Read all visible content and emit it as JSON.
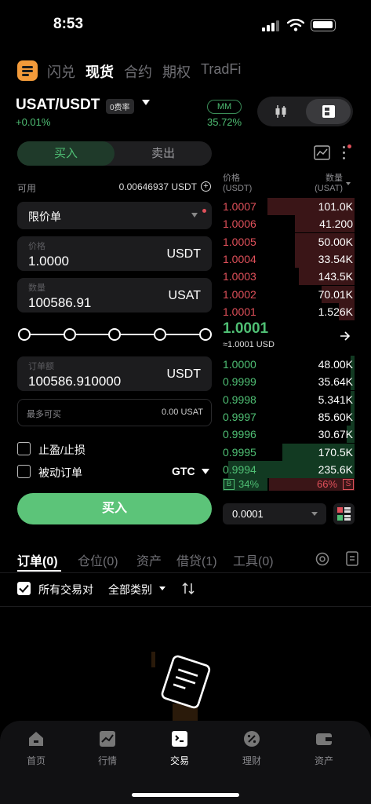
{
  "status_bar": {
    "time": "8:53"
  },
  "top_nav": {
    "items": [
      "闪兑",
      "现货",
      "合约",
      "期权",
      "TradFi"
    ],
    "active": "现货"
  },
  "pair": {
    "name": "USAT/USDT",
    "fee_badge": "0费率",
    "change": "+0.01%",
    "mm_label": "MM",
    "mm_value": "35.72%"
  },
  "trade_form": {
    "buy_tab": "买入",
    "sell_tab": "卖出",
    "available_label": "可用",
    "available_value": "0.00646937 USDT",
    "order_type": "限价单",
    "price_label": "价格",
    "price_value": "1.0000",
    "price_unit": "USDT",
    "qty_label": "数量",
    "qty_value": "100586.91",
    "qty_unit": "USAT",
    "amount_label": "订单额",
    "amount_value": "100586.910000",
    "amount_unit": "USDT",
    "max_buy_label": "最多可买",
    "max_buy_value": "0.00 USAT",
    "tp_sl_label": "止盈/止损",
    "passive_label": "被动订单",
    "tif_value": "GTC",
    "buy_button": "买入"
  },
  "order_book": {
    "price_header": "价格",
    "price_unit": "(USDT)",
    "qty_header": "数量",
    "qty_unit": "(USAT)",
    "asks": [
      {
        "price": "1.0007",
        "qty": "101.0K",
        "depth": 0.66
      },
      {
        "price": "1.0006",
        "qty": "41.200",
        "depth": 0.45
      },
      {
        "price": "1.0005",
        "qty": "50.00K",
        "depth": 0.45
      },
      {
        "price": "1.0004",
        "qty": "33.54K",
        "depth": 0.45
      },
      {
        "price": "1.0003",
        "qty": "143.5K",
        "depth": 0.42
      },
      {
        "price": "1.0002",
        "qty": "70.01K",
        "depth": 0.25
      },
      {
        "price": "1.0001",
        "qty": "1.526K",
        "depth": 0.12
      }
    ],
    "last_price": "1.0001",
    "last_price_usd": "≈1.0001 USD",
    "bids": [
      {
        "price": "1.0000",
        "qty": "48.00K",
        "depth": 0.03
      },
      {
        "price": "0.9999",
        "qty": "35.64K",
        "depth": 0.03
      },
      {
        "price": "0.9998",
        "qty": "5.341K",
        "depth": 0.03
      },
      {
        "price": "0.9997",
        "qty": "85.60K",
        "depth": 0.03
      },
      {
        "price": "0.9996",
        "qty": "30.67K",
        "depth": 0.06
      },
      {
        "price": "0.9995",
        "qty": "170.5K",
        "depth": 0.55
      },
      {
        "price": "0.9994",
        "qty": "235.6K",
        "depth": 0.96
      }
    ],
    "buy_ratio_label": "B",
    "buy_ratio": "34%",
    "sell_ratio": "66%",
    "sell_ratio_label": "S",
    "precision": "0.0001"
  },
  "order_tabs": [
    {
      "label": "订单(0)"
    },
    {
      "label": "仓位(0)"
    },
    {
      "label": "资产"
    },
    {
      "label": "借贷(1)"
    },
    {
      "label": "工具(0)"
    }
  ],
  "filters": {
    "all_pairs_label": "所有交易对",
    "category_label": "全部类别"
  },
  "bottom_nav": [
    {
      "label": "首页",
      "icon": "home-icon"
    },
    {
      "label": "行情",
      "icon": "chart-icon"
    },
    {
      "label": "交易",
      "icon": "trade-icon"
    },
    {
      "label": "理财",
      "icon": "finance-icon"
    },
    {
      "label": "资产",
      "icon": "wallet-icon"
    }
  ],
  "colors": {
    "buy": "#4fbf74",
    "sell": "#e0505a",
    "accent": "#f29a3a"
  }
}
